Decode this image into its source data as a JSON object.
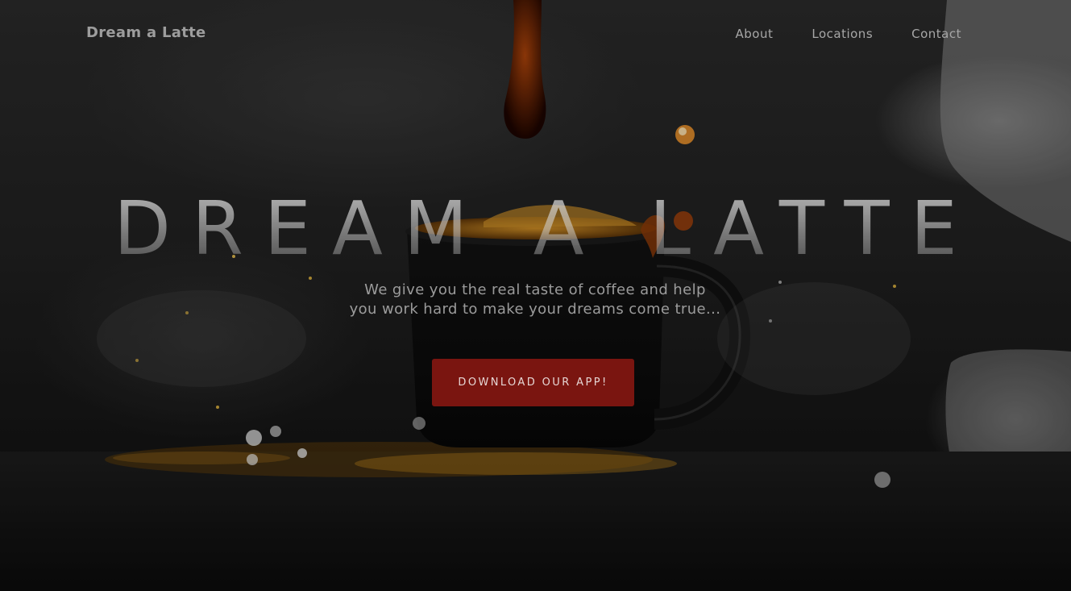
{
  "nav": {
    "brand": "Dream a Latte",
    "links": [
      {
        "label": "About"
      },
      {
        "label": "Locations"
      },
      {
        "label": "Contact"
      }
    ]
  },
  "hero": {
    "title": "DREAM A LATTE",
    "subtitle_line1": "We give you the real taste of coffee and help",
    "subtitle_line2": "you work hard to make your dreams come true...",
    "cta_label": "DOWNLOAD OUR APP!"
  },
  "colors": {
    "cta_background": "#7a1510",
    "background": "#141414",
    "coffee_accent": "#b86a12"
  },
  "background_image": {
    "subject": "coffee-cup-splash-image"
  }
}
